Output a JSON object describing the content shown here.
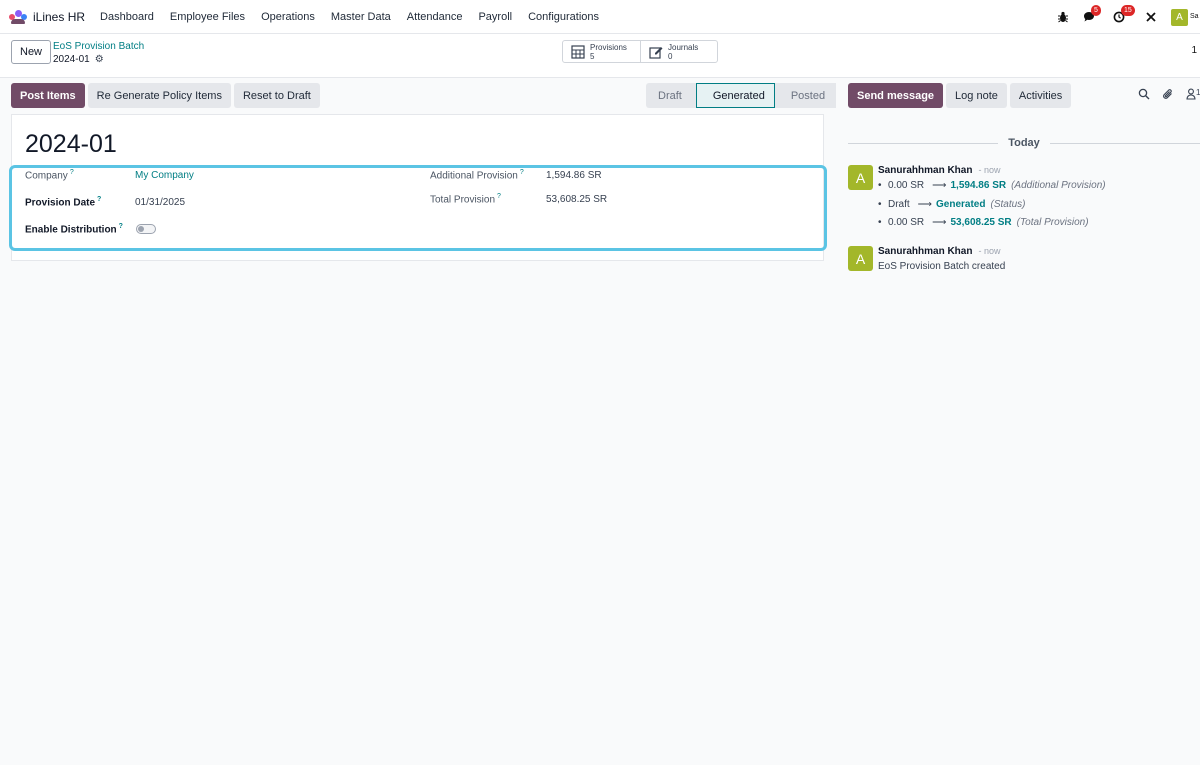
{
  "navbar": {
    "app_name": "iLines HR",
    "menu": [
      "Dashboard",
      "Employee Files",
      "Operations",
      "Master Data",
      "Attendance",
      "Payroll",
      "Configurations"
    ],
    "messages_badge": "5",
    "activities_badge": "15",
    "user_initial": "A",
    "user_name_fragment": "Sa"
  },
  "control": {
    "new_label": "New",
    "breadcrumb_parent": "EoS Provision Batch",
    "breadcrumb_current": "2024-01",
    "smart_provisions_label": "Provisions",
    "smart_provisions_count": "5",
    "smart_journals_label": "Journals",
    "smart_journals_count": "0",
    "pager": "1"
  },
  "statusbar": {
    "post_items": "Post Items",
    "regenerate": "Re Generate Policy Items",
    "reset_draft": "Reset to Draft",
    "steps": [
      "Draft",
      "Generated",
      "Posted"
    ],
    "active_step": "Generated"
  },
  "form": {
    "title": "2024-01",
    "company_label": "Company",
    "company_value": "My Company",
    "provision_date_label": "Provision Date",
    "provision_date_value": "01/31/2025",
    "enable_distribution_label": "Enable Distribution",
    "enable_distribution_value": false,
    "additional_provision_label": "Additional Provision",
    "additional_provision_value": "1,594.86 SR",
    "total_provision_label": "Total Provision",
    "total_provision_value": "53,608.25 SR",
    "help_mark": "?"
  },
  "chatter": {
    "send_message": "Send message",
    "log_note": "Log note",
    "activities": "Activities",
    "followers_count": "1",
    "today": "Today",
    "messages": [
      {
        "author": "Sanurahhman Khan",
        "time": "- now",
        "initial": "A",
        "changes": [
          {
            "old": "0.00 SR",
            "new": "1,594.86 SR",
            "field": "(Additional Provision)"
          },
          {
            "old": "Draft",
            "new": "Generated",
            "field": "(Status)"
          },
          {
            "old": "0.00 SR",
            "new": "53,608.25 SR",
            "field": "(Total Provision)"
          }
        ]
      },
      {
        "author": "Sanurahhman Khan",
        "time": "- now",
        "initial": "A",
        "body": "EoS Provision Batch created"
      }
    ]
  },
  "colors": {
    "primary": "#714b67",
    "link": "#017e84",
    "highlight": "#5bc4e4",
    "avatar": "#a3b72a",
    "badge": "#dc2626"
  }
}
